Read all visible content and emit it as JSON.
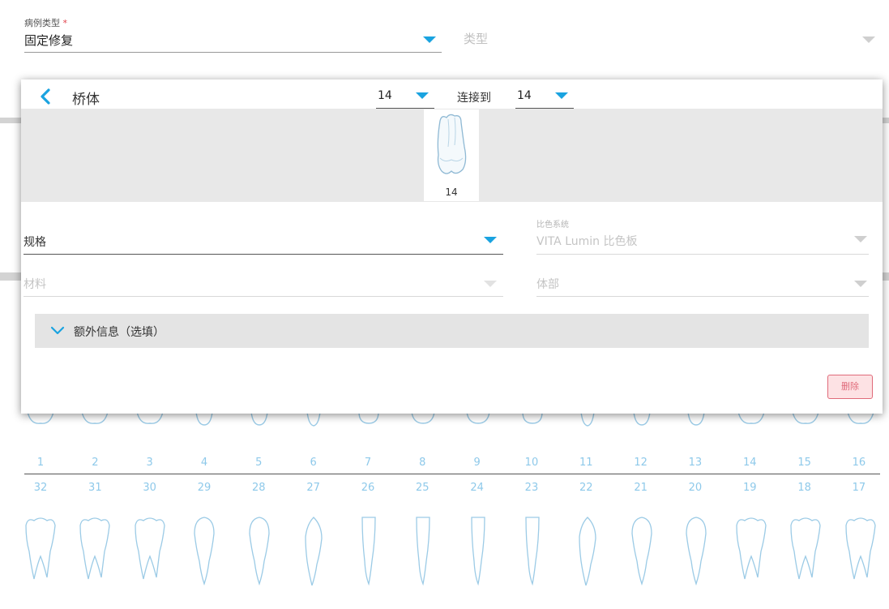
{
  "background": {
    "case_type": {
      "label": "病例类型",
      "required_mark": "*",
      "value": "固定修复"
    },
    "type_field": {
      "placeholder": "类型"
    },
    "upper_numbers": [
      "1",
      "2",
      "3",
      "4",
      "5",
      "6",
      "7",
      "8",
      "9",
      "10",
      "11",
      "12",
      "13",
      "14",
      "15",
      "16"
    ],
    "lower_numbers": [
      "32",
      "31",
      "30",
      "29",
      "28",
      "27",
      "26",
      "25",
      "24",
      "23",
      "22",
      "21",
      "20",
      "19",
      "18",
      "17"
    ]
  },
  "dialog": {
    "title": "桥体",
    "from_tooth": "14",
    "connect_label": "连接到",
    "to_tooth": "14",
    "selected_tooth": "14",
    "spec_label": "规格",
    "shade_system_label": "比色系统",
    "shade_system_value": "VITA Lumin 比色板",
    "material_label": "材料",
    "body_label": "体部",
    "extra_info_label": "额外信息（选填）",
    "delete_label": "删除"
  },
  "colors": {
    "accent": "#1aa3e0",
    "tooth_number": "#8ec9ea",
    "delete_text": "#e06b7a",
    "delete_bg": "#fde2e4",
    "band": "#e8e8e8",
    "extra_bar": "#e4e4e4"
  },
  "icons": {
    "back": "chevron-left-icon",
    "dropdown": "triangle-down-icon",
    "expand": "chevron-down-icon",
    "tooth": "tooth-icon"
  }
}
